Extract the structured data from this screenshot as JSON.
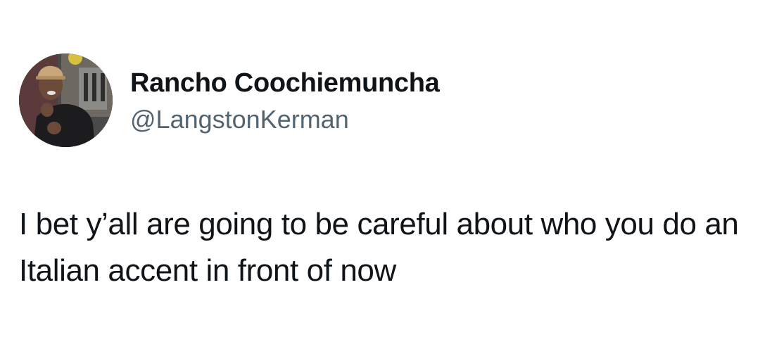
{
  "author": {
    "display_name": "Rancho Coochiemuncha",
    "handle": "@LangstonKerman",
    "avatar_icon": "profile-photo"
  },
  "tweet": {
    "text": "I bet y’all are going to be careful about who you do an Italian accent in front of now"
  },
  "colors": {
    "background": "#ffffff",
    "primary_text": "#0f1419",
    "secondary_text": "#536471"
  }
}
